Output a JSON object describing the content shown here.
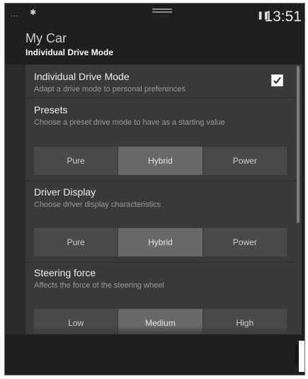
{
  "status_bar": {
    "signal_text": "...",
    "bluetooth_icon": "bluetooth-icon",
    "pause_icon": "pause-icon",
    "time": "13:51"
  },
  "header": {
    "app_title": "My Car",
    "sub_title": "Individual Drive Mode"
  },
  "settings": {
    "drive_mode": {
      "label": "Individual Drive Mode",
      "description": "Adapt a drive mode to personal preferences",
      "checked": true
    },
    "presets": {
      "label": "Presets",
      "description": "Choose a preset drive mode to have as a starting value",
      "options": [
        "Pure",
        "Hybrid",
        "Power"
      ],
      "selected": "Hybrid"
    },
    "driver_display": {
      "label": "Driver Display",
      "description": "Choose driver display characteristics",
      "options": [
        "Pure",
        "Hybrid",
        "Power"
      ],
      "selected": "Hybrid"
    },
    "steering_force": {
      "label": "Steering force",
      "description": "Affects the force of the steering wheel",
      "options": [
        "Low",
        "Medium",
        "High"
      ],
      "selected": "Medium"
    }
  },
  "image_code": "G063300",
  "colors": {
    "background": "#1f1f1f",
    "panel": "#3a3a3a",
    "segment": "#4a4a4a",
    "segment_selected": "#696969"
  }
}
